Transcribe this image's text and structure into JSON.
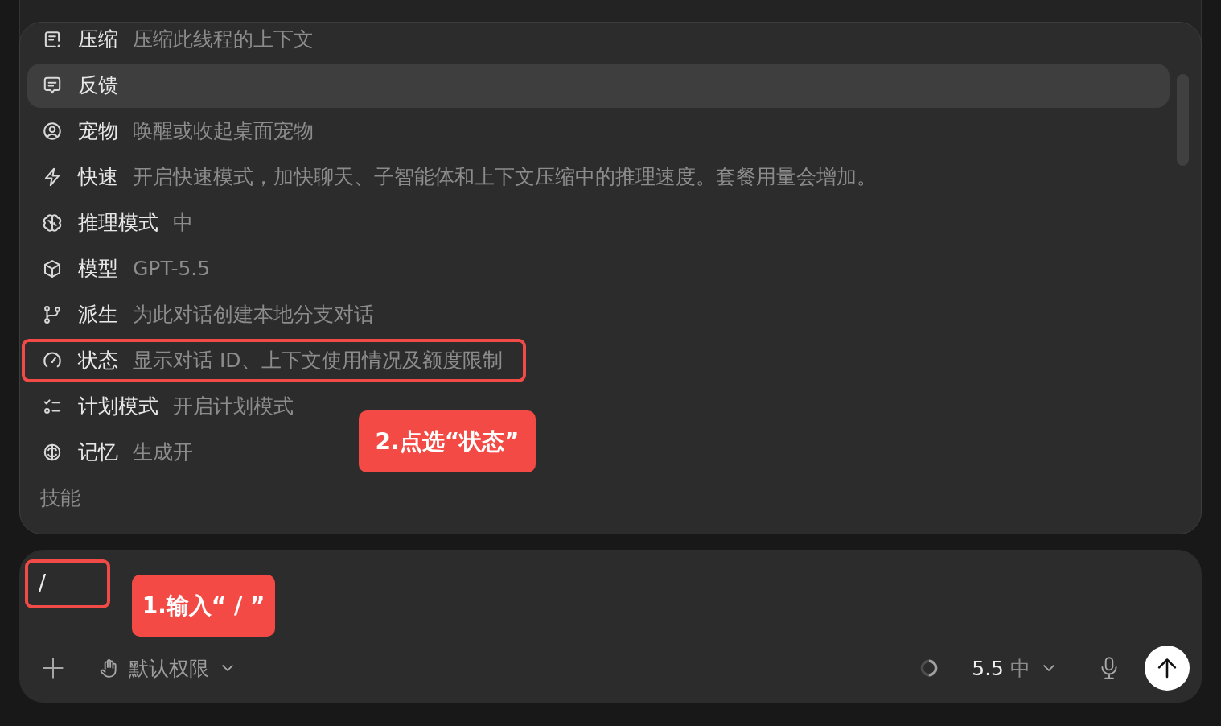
{
  "menu": {
    "items": [
      {
        "label": "压缩",
        "description": "压缩此线程的上下文",
        "selected": false,
        "outlined": false
      },
      {
        "label": "反馈",
        "selected": true,
        "outlined": false
      },
      {
        "label": "宠物",
        "description": "唤醒或收起桌面宠物",
        "selected": false,
        "outlined": false
      },
      {
        "label": "快速",
        "description": "开启快速模式，加快聊天、子智能体和上下文压缩中的推理速度。套餐用量会增加。",
        "selected": false,
        "outlined": false
      },
      {
        "label": "推理模式",
        "description": "中",
        "selected": false,
        "outlined": false
      },
      {
        "label": "模型",
        "description": "GPT-5.5",
        "selected": false,
        "outlined": false
      },
      {
        "label": "派生",
        "description": "为此对话创建本地分支对话",
        "selected": false,
        "outlined": false
      },
      {
        "label": "状态",
        "description": "显示对话 ID、上下文使用情况及额度限制",
        "selected": false,
        "outlined": true
      },
      {
        "label": "计划模式",
        "description": "开启计划模式",
        "selected": false,
        "outlined": false
      },
      {
        "label": "记忆",
        "description": "生成开",
        "selected": false,
        "outlined": false
      }
    ],
    "section_heading": "技能",
    "callout": {
      "text": "2.点选“状态”"
    }
  },
  "composer": {
    "input": {
      "value": "/",
      "outlined": true
    },
    "callout": {
      "text": "1.输入“ / ”"
    },
    "permission": {
      "label": "默认权限"
    },
    "context_usage": {
      "level": 0.5
    },
    "model": {
      "version": "5.5",
      "effort": "中"
    }
  }
}
